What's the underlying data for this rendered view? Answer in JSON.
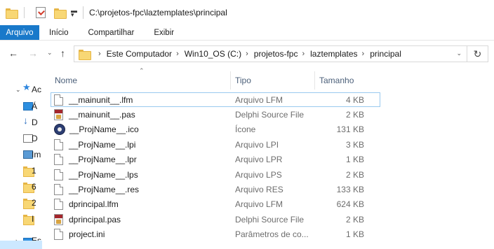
{
  "window": {
    "title": "C:\\projetos-fpc\\laztemplates\\principal"
  },
  "ribbon": {
    "tabs": [
      {
        "label": "Arquivo"
      },
      {
        "label": "Início"
      },
      {
        "label": "Compartilhar"
      },
      {
        "label": "Exibir"
      }
    ]
  },
  "address": {
    "breadcrumbs": [
      "Este Computador",
      "Win10_OS (C:)",
      "projetos-fpc",
      "laztemplates",
      "principal"
    ]
  },
  "navpane": {
    "items": [
      {
        "label": "Ac",
        "icon": "star-icon"
      },
      {
        "label": "Á",
        "icon": "desktop-icon"
      },
      {
        "label": "D",
        "icon": "download-icon"
      },
      {
        "label": "D",
        "icon": "document-icon"
      },
      {
        "label": "Im",
        "icon": "image-icon"
      },
      {
        "label": "1",
        "icon": "folder-icon"
      },
      {
        "label": "6",
        "icon": "folder-icon"
      },
      {
        "label": "2",
        "icon": "folder-icon"
      },
      {
        "label": "I",
        "icon": "folder-icon"
      },
      {
        "label": "Es",
        "icon": "pc-icon"
      }
    ]
  },
  "columns": {
    "name": "Nome",
    "type": "Tipo",
    "size": "Tamanho"
  },
  "files": [
    {
      "name": "__mainunit__.lfm",
      "type": "Arquivo LFM",
      "size": "4 KB",
      "icon": "doc"
    },
    {
      "name": "__mainunit__.pas",
      "type": "Delphi Source File",
      "size": "2 KB",
      "icon": "pas"
    },
    {
      "name": "__ProjName__.ico",
      "type": "Ícone",
      "size": "131 KB",
      "icon": "ico"
    },
    {
      "name": "__ProjName__.lpi",
      "type": "Arquivo LPI",
      "size": "3 KB",
      "icon": "doc"
    },
    {
      "name": "__ProjName__.lpr",
      "type": "Arquivo LPR",
      "size": "1 KB",
      "icon": "doc"
    },
    {
      "name": "__ProjName__.lps",
      "type": "Arquivo LPS",
      "size": "2 KB",
      "icon": "doc"
    },
    {
      "name": "__ProjName__.res",
      "type": "Arquivo RES",
      "size": "133 KB",
      "icon": "doc"
    },
    {
      "name": "dprincipal.lfm",
      "type": "Arquivo LFM",
      "size": "624 KB",
      "icon": "doc"
    },
    {
      "name": "dprincipal.pas",
      "type": "Delphi Source File",
      "size": "2 KB",
      "icon": "pas"
    },
    {
      "name": "project.ini",
      "type": "Parâmetros de co...",
      "size": "1 KB",
      "icon": "doc"
    }
  ],
  "colors": {
    "accent": "#1979ca",
    "header_text": "#4c607a",
    "focus_border": "#99c9ef"
  }
}
